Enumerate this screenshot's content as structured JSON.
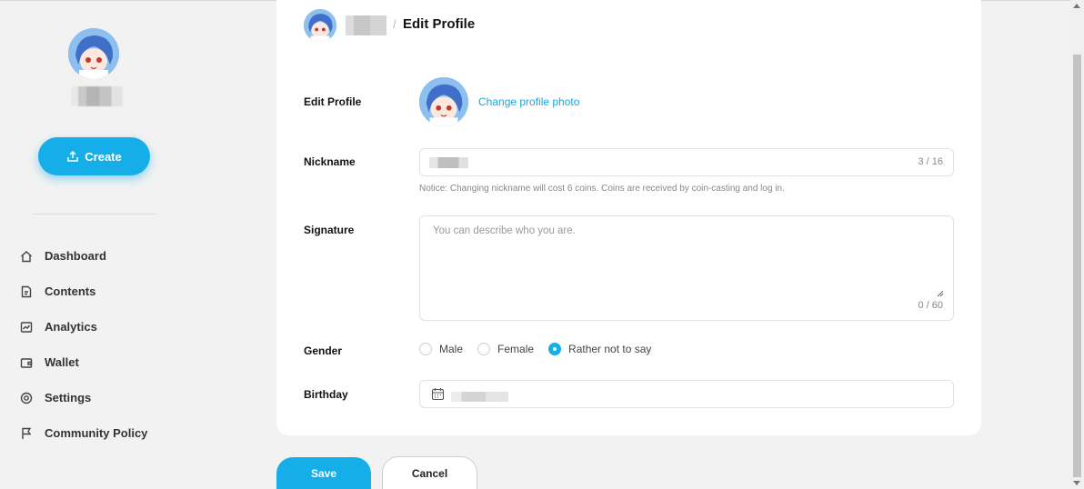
{
  "sidebar": {
    "create_label": "Create",
    "items": [
      {
        "label": "Dashboard",
        "icon": "home-icon"
      },
      {
        "label": "Contents",
        "icon": "document-icon"
      },
      {
        "label": "Analytics",
        "icon": "chart-icon"
      },
      {
        "label": "Wallet",
        "icon": "wallet-icon"
      },
      {
        "label": "Settings",
        "icon": "gear-icon"
      },
      {
        "label": "Community Policy",
        "icon": "flag-icon"
      }
    ]
  },
  "header": {
    "separator": "/",
    "title": "Edit Profile"
  },
  "form": {
    "photo_label": "Edit Profile",
    "change_photo": "Change profile photo",
    "nickname_label": "Nickname",
    "nickname_counter": "3 / 16",
    "nickname_notice": "Notice: Changing nickname will cost 6 coins. Coins are received by coin-casting and log in.",
    "signature_label": "Signature",
    "signature_placeholder": "You can describe who you are.",
    "signature_counter": "0 / 60",
    "gender_label": "Gender",
    "gender_options": [
      "Male",
      "Female",
      "Rather not to say"
    ],
    "gender_selected": "Rather not to say",
    "birthday_label": "Birthday"
  },
  "actions": {
    "save": "Save",
    "cancel": "Cancel"
  },
  "colors": {
    "accent": "#16aee8",
    "link": "#1aa6e0",
    "background": "#f2f2f2"
  }
}
